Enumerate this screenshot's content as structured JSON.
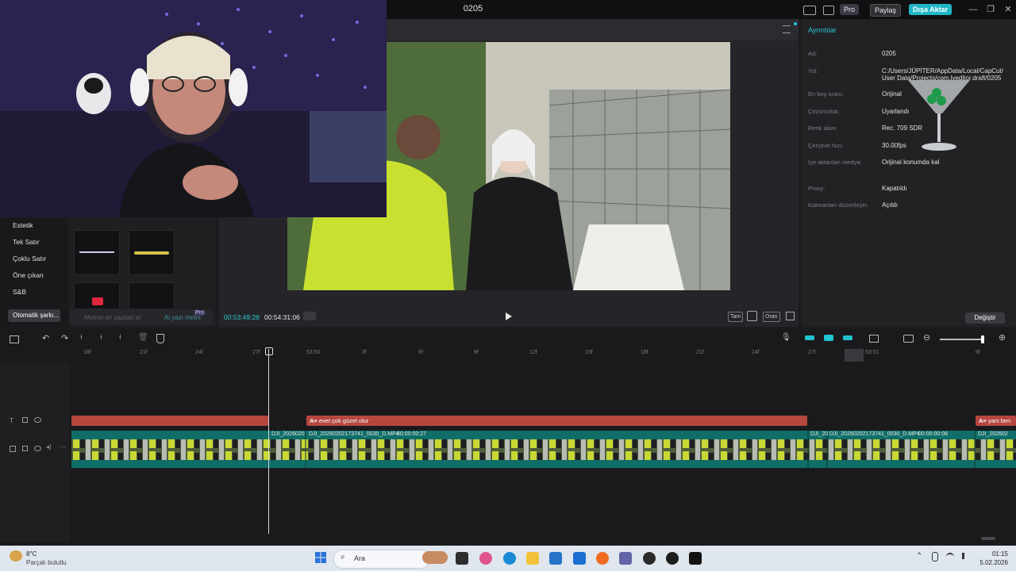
{
  "window": {
    "title": "0205",
    "pro_label": "Pro",
    "share_label": "Paylaş",
    "export_label": "Dışa Aktar",
    "minimize": "—",
    "maximize": "❐",
    "close": "✕"
  },
  "left_panel": {
    "categories": [
      "Estetik",
      "Tek Satır",
      "Çoklu Satır",
      "Öne çıkan",
      "S&B"
    ],
    "active_category": "Otomatik şarkı...",
    "search_placeholder": "Metnəi air yazılan al",
    "search_hint": "Ai yazı metni",
    "search_pro": "Pro"
  },
  "player": {
    "current_time": "00:53:49:28",
    "total_time": "00:54:31:06",
    "ctl_full": "Tam",
    "ctl_ratio": "Oran"
  },
  "details": {
    "tab": "Ayrıntılar",
    "rows": [
      {
        "label": "Ad:",
        "value": "0205"
      },
      {
        "label": "Yol:",
        "value": "C:/Users/JÜPİTER/AppData/Local/CapCut/",
        "value2": "User Data/Projects/com.lveditor.draft/0205"
      },
      {
        "label": "En boy oranı:",
        "value": "Orijinal"
      },
      {
        "label": "Çözünürlük:",
        "value": "Uyarlandı"
      },
      {
        "label": "Renk alanı",
        "value": "Rec. 709 SDR"
      },
      {
        "label": "Çerçeve hızı:",
        "value": "30.00fps"
      },
      {
        "label": "İçe aktarılan medya:",
        "value": "Orijinal konumda kal"
      },
      {
        "label": "Proxy:",
        "value": "Kapatıldı"
      },
      {
        "label": "Katmanları düzenleyin",
        "value": "Açıldı"
      }
    ],
    "change_label": "Değiştir"
  },
  "timeline": {
    "ruler_ticks": [
      "18f",
      "21f",
      "24f",
      "27f",
      "53:50",
      "3f",
      "6f",
      "9f",
      "12f",
      "15f",
      "18f",
      "21f",
      "24f",
      "27f",
      "53:51",
      "6f"
    ],
    "text_clips": [
      "",
      "evet çok güzel olur",
      "yani ben"
    ],
    "video_clips": [
      "DJI_2026020",
      "DJI_20260202173741_0030_D.MP4",
      "00:00:00:27",
      "DJI_20",
      "DJI_20260202173741_0030_D.MP4",
      "00:00:00:08",
      "DJI_202602"
    ]
  },
  "taskbar": {
    "temp": "8°C",
    "weather": "Parçalı bulutlu",
    "search": "Ara",
    "time": "01:15",
    "date": "5.02.2026"
  }
}
